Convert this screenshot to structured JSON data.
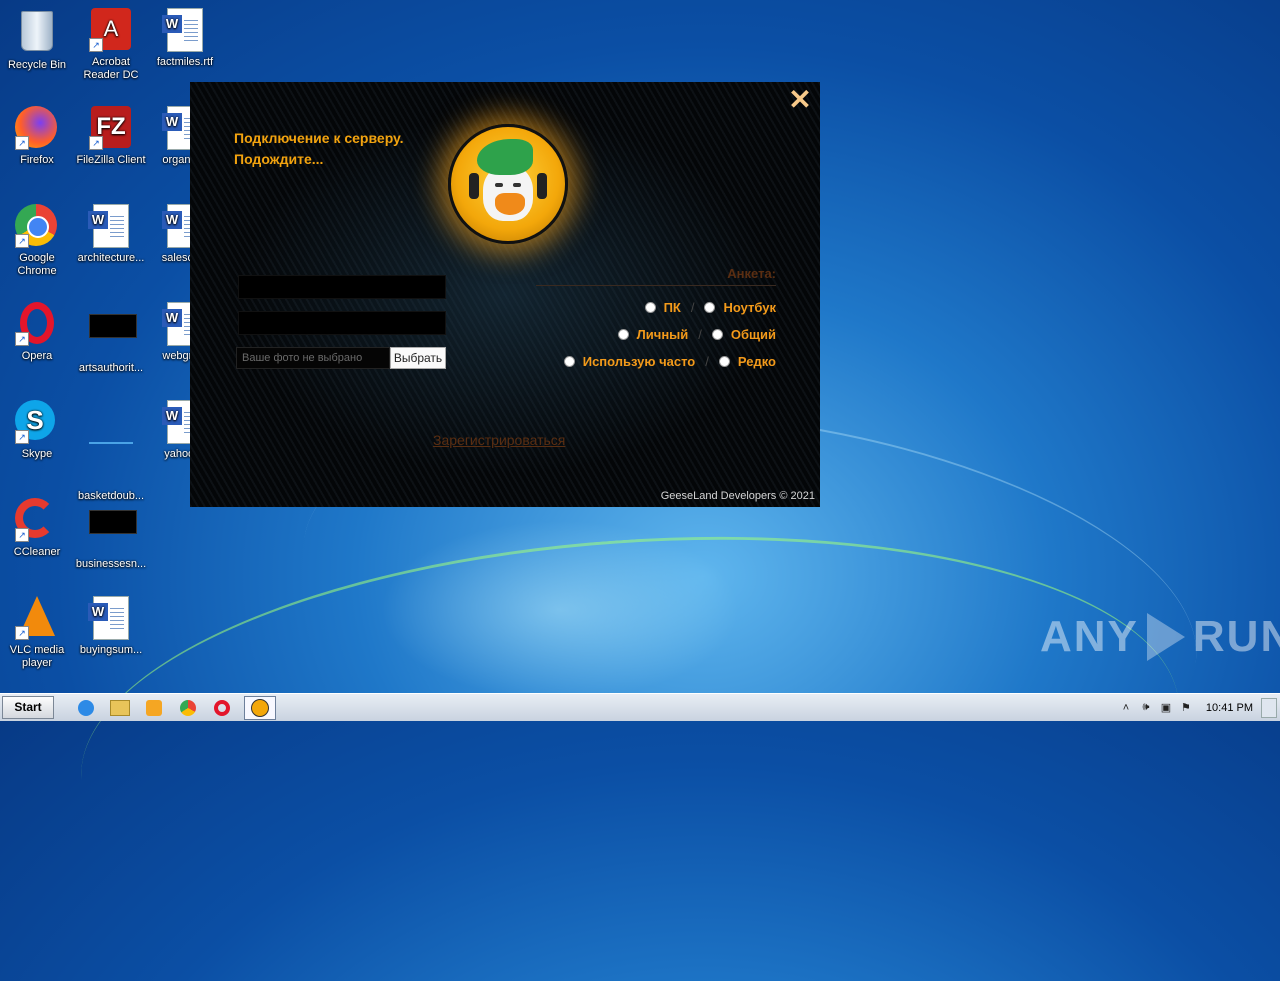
{
  "desktop": {
    "icons": [
      {
        "label": "Recycle Bin"
      },
      {
        "label": "Acrobat Reader DC"
      },
      {
        "label": "factmiles.rtf"
      },
      {
        "label": "Firefox"
      },
      {
        "label": "FileZilla Client"
      },
      {
        "label": "organiz..."
      },
      {
        "label": "Google Chrome"
      },
      {
        "label": "architecture..."
      },
      {
        "label": "salesca..."
      },
      {
        "label": "Opera"
      },
      {
        "label": "artsauthorit..."
      },
      {
        "label": "webgre..."
      },
      {
        "label": "Skype"
      },
      {
        "label": "basketdoub..."
      },
      {
        "label": "yahooi..."
      },
      {
        "label": "CCleaner"
      },
      {
        "label": "businessesn..."
      },
      {
        "label": "VLC media player"
      },
      {
        "label": "buyingsum..."
      }
    ]
  },
  "dialog": {
    "status_line1": "Подключение к серверу.",
    "status_line2": "Подождите...",
    "close_glyph": "✕",
    "file_placeholder": "Ваше фото не выбрано",
    "choose_button": "Выбрать",
    "survey": {
      "title": "Анкета:",
      "rows": [
        {
          "a": "ПК",
          "b": "Ноутбук"
        },
        {
          "a": "Личный",
          "b": "Общий"
        },
        {
          "a": "Использую часто",
          "b": "Редко"
        }
      ],
      "separator": "/"
    },
    "register_link": "Зарегистрироваться",
    "footer": "GeeseLand Developers © 2021"
  },
  "watermark": {
    "left": "ANY",
    "right": "RUN"
  },
  "taskbar": {
    "start_label": "Start",
    "clock": "10:41 PM"
  },
  "colors": {
    "accent": "#f39a1a",
    "status": "#f2a30f",
    "register": "#5a2e12"
  }
}
